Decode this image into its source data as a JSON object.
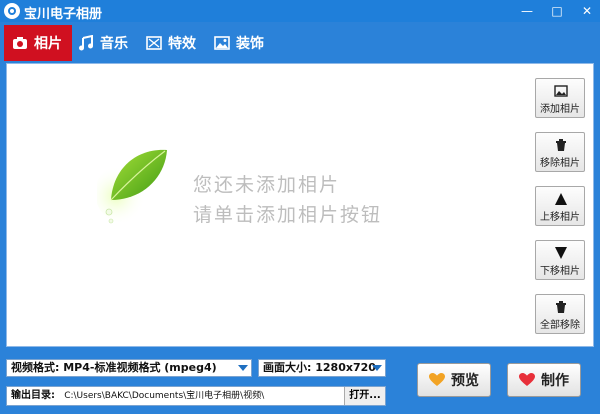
{
  "window": {
    "title": "宝川电子相册",
    "controls": [
      "minimize",
      "maximize",
      "close"
    ]
  },
  "tabs": [
    {
      "label": "相片",
      "icon": "camera-icon",
      "active": true
    },
    {
      "label": "音乐",
      "icon": "music-note-icon",
      "active": false
    },
    {
      "label": "特效",
      "icon": "effect-icon",
      "active": false
    },
    {
      "label": "装饰",
      "icon": "picture-icon",
      "active": false
    }
  ],
  "content": {
    "empty_line1": "您还未添加相片",
    "empty_line2": "请单击添加相片按钮"
  },
  "side_buttons": [
    {
      "label": "添加相片",
      "icon": "image-icon"
    },
    {
      "label": "移除相片",
      "icon": "trash-icon"
    },
    {
      "label": "上移相片",
      "icon": "arrow-up-icon"
    },
    {
      "label": "下移相片",
      "icon": "arrow-down-icon"
    },
    {
      "label": "全部移除",
      "icon": "trash-icon"
    }
  ],
  "bottom": {
    "video_format": "视频格式: MP4-标准视频格式 (mpeg4)",
    "frame_size": "画面大小: 1280x720",
    "output_label": "输出目录:",
    "output_path": "C:\\Users\\BAKC\\Documents\\宝川电子相册\\视频\\",
    "open_label": "打开...",
    "preview_label": "预览",
    "make_label": "制作"
  },
  "colors": {
    "frame": "#2b82d9",
    "active_tab": "#d01020",
    "empty_text": "#bdbdbd"
  }
}
